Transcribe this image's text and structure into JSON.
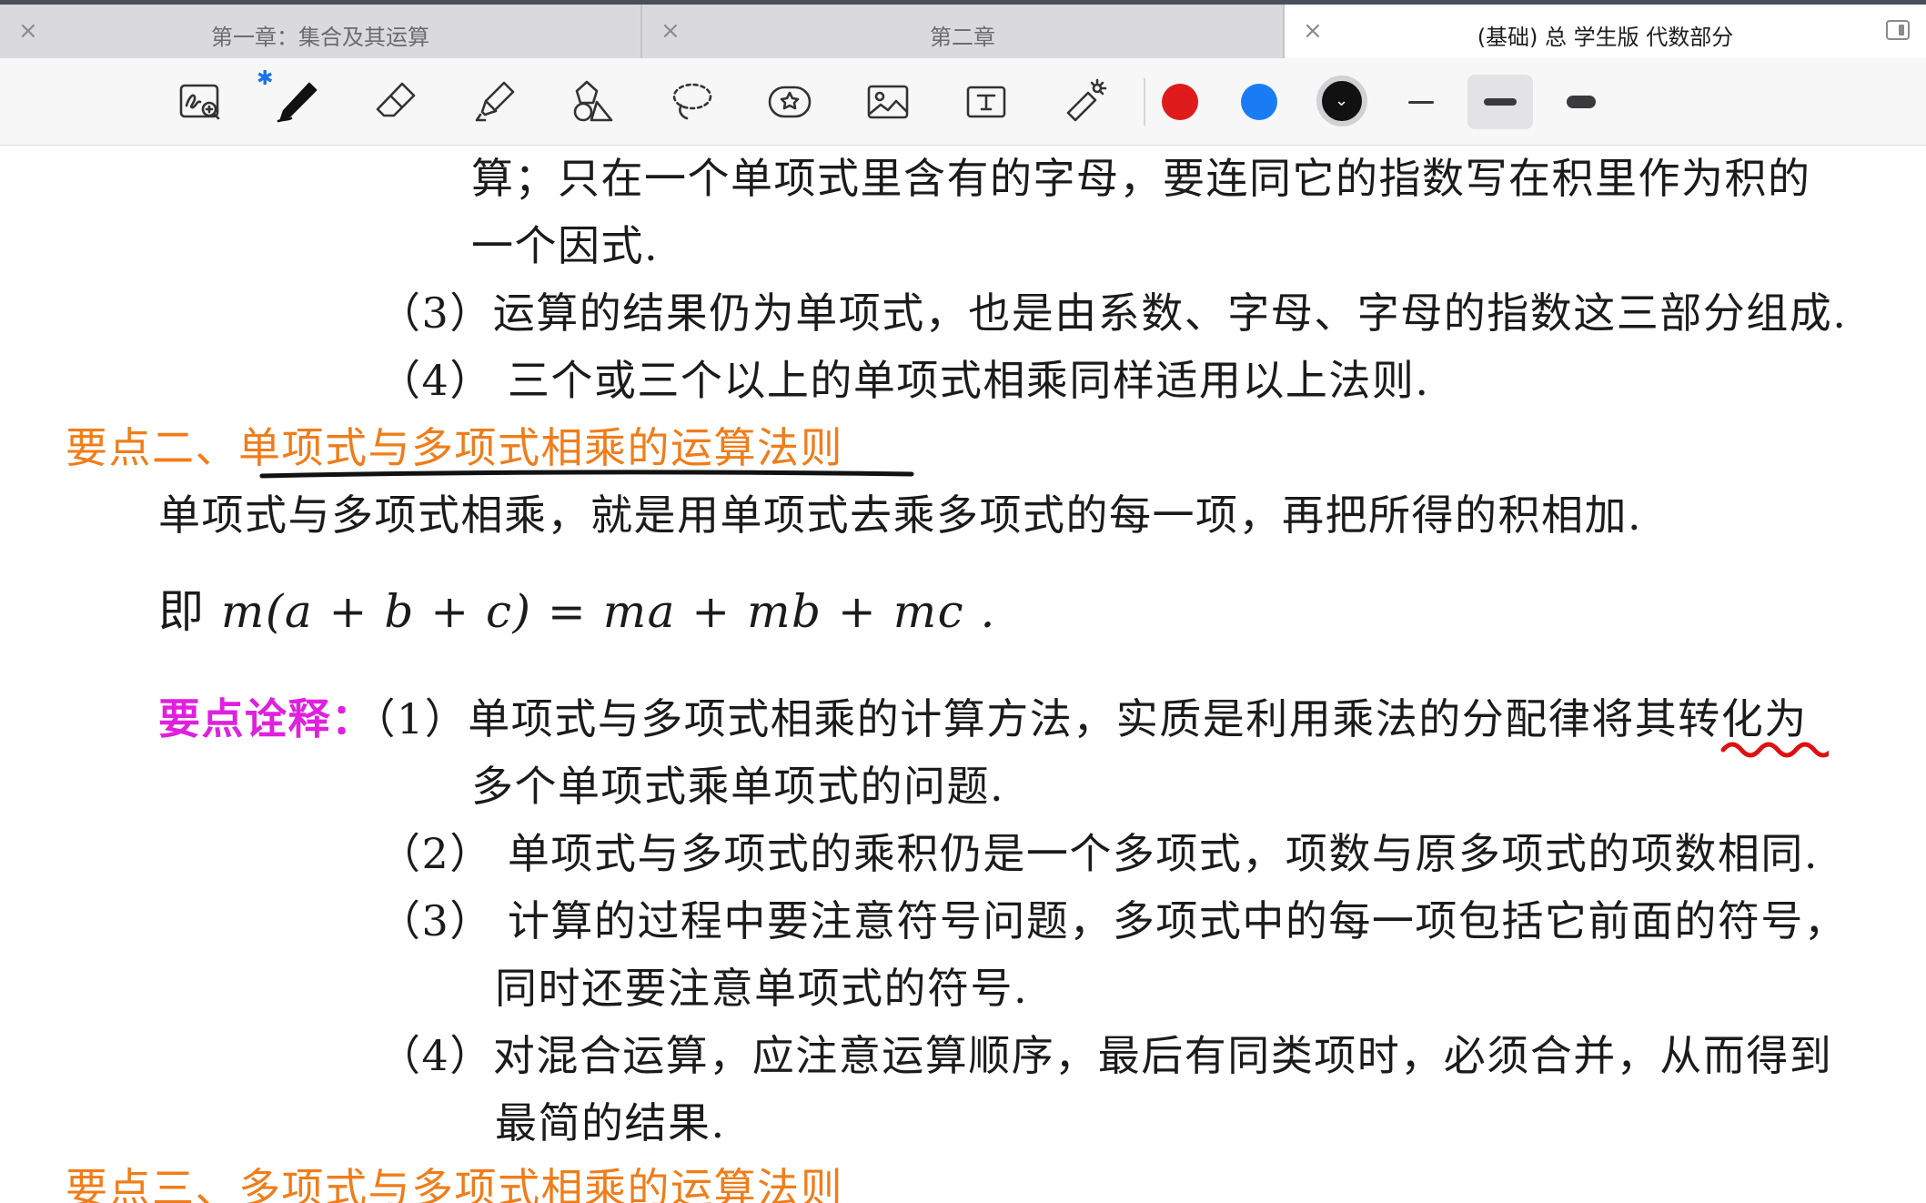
{
  "tabs": [
    {
      "label": "第一章：集合及其运算",
      "close": "×"
    },
    {
      "label": "第二章",
      "close": "×"
    },
    {
      "label": "(基础) 总 学生版 代数部分",
      "close": "×"
    }
  ],
  "toolbar": {
    "tools": [
      "zoom-handwriting-icon",
      "pen-icon",
      "eraser-icon",
      "highlighter-icon",
      "shapes-icon",
      "lasso-icon",
      "sticker-icon",
      "image-icon",
      "text-box-icon",
      "laser-pointer-icon"
    ],
    "bluetooth_mark": "✱",
    "colors": [
      "#e01b1b",
      "#1a7cf5",
      "#111111"
    ],
    "selected_color": "#111111",
    "stroke_widths": [
      "thin",
      "medium",
      "thick"
    ],
    "selected_stroke": "medium"
  },
  "document": {
    "p1_line1": "算；只在一个单项式里含有的字母，要连同它的指数写在积里作为积的",
    "p1_line2": "一个因式.",
    "item3": "（3）运算的结果仍为单项式，也是由系数、字母、字母的指数这三部分组成.",
    "item4": "（4） 三个或三个以上的单项式相乘同样适用以上法则.",
    "heading2_prefix": "要点二、",
    "heading2_title": "单项式与多项式相乘的运算法则",
    "rule_text": "单项式与多项式相乘，就是用单项式去乘多项式的每一项，再把所得的积相加.",
    "formula_prefix": "即",
    "formula": "m(a + b + c) = ma + mb + mc .",
    "note_label": "要点诠释：",
    "note1_a": "（1）单项式与多项式相乘的计算方法，实质是利用乘法的分配律将其转化为",
    "note1_b": "多个单项式乘单项式的问题.",
    "note2": "（2） 单项式与多项式的乘积仍是一个多项式，项数与原多项式的项数相同.",
    "note3_a": "（3） 计算的过程中要注意符号问题，多项式中的每一项包括它前面的符号，",
    "note3_b": "同时还要注意单项式的符号.",
    "note4_a": "（4）对混合运算，应注意运算顺序，最后有同类项时，必须合并，从而得到",
    "note4_b": "最简的结果.",
    "heading3": "要点三、多项式与多项式相乘的运算法则"
  }
}
